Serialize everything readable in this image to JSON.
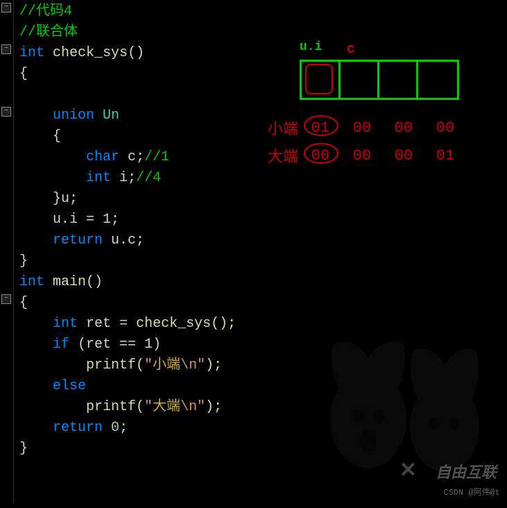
{
  "code": {
    "l1": "//代码4",
    "l2": "//联合体",
    "l3_type": "int",
    "l3_func": "check_sys",
    "l4": "{",
    "l6_kw": "union",
    "l6_name": "Un",
    "l7": "{",
    "l8_type": "char",
    "l8_var": "c",
    "l8_comment": "//1",
    "l9_type": "int",
    "l9_var": "i",
    "l9_comment": "//4",
    "l10": "}u;",
    "l11": "u.i = 1;",
    "l12_kw": "return",
    "l12_expr": "u.c;",
    "l13": "}",
    "l14_type": "int",
    "l14_func": "main",
    "l15": "{",
    "l16_type": "int",
    "l16_var": "ret",
    "l16_call": "check_sys",
    "l17_kw": "if",
    "l17_cond": "(ret == 1)",
    "l18_func": "printf",
    "l18_str1": "\"",
    "l18_cn": "小端",
    "l18_str2": "\\n\"",
    "l19_kw": "else",
    "l20_func": "printf",
    "l20_str1": "\"",
    "l20_cn": "大端",
    "l20_str2": "\\n\"",
    "l21_kw": "return",
    "l21_val": "0",
    "l22": "}"
  },
  "diagram": {
    "ui_label": "u.i",
    "c_label": "c",
    "little_endian_label": "小端",
    "big_endian_label": "大端",
    "little_endian": [
      "01",
      "00",
      "00",
      "00"
    ],
    "big_endian": [
      "00",
      "00",
      "00",
      "01"
    ]
  },
  "watermark": "CSDN @阿伟@t",
  "logo": "自由互联"
}
